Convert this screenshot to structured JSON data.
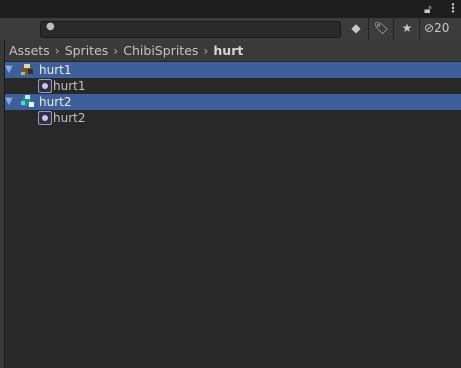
{
  "toolbar": {
    "hidden_count": "20",
    "icons": [
      "search-icon",
      "type-filter-icon",
      "label-filter-icon",
      "favorite-icon",
      "visibility-icon"
    ]
  },
  "breadcrumb": {
    "items": [
      "Assets",
      "Sprites",
      "ChibiSprites",
      "hurt"
    ]
  },
  "tree": {
    "rows": [
      {
        "label": "hurt1",
        "selected": true,
        "expanded": true
      },
      {
        "label": "hurt1",
        "child": true
      },
      {
        "label": "hurt2",
        "selected": true,
        "expanded": true
      },
      {
        "label": "hurt2",
        "child": true
      }
    ]
  },
  "colors": {
    "selection": "#3d5f9a",
    "panel": "#282828",
    "toolbar": "#3c3c3c"
  }
}
